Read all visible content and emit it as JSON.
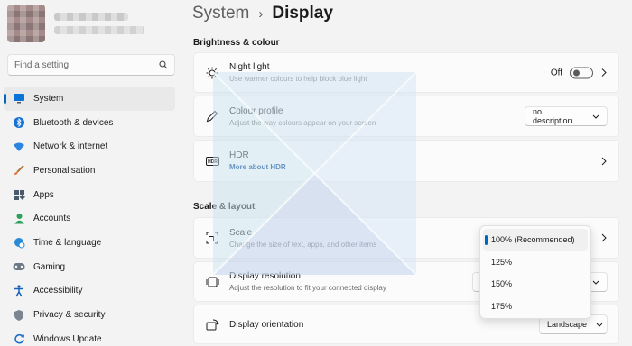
{
  "search": {
    "placeholder": "Find a setting"
  },
  "sidebar": {
    "items": [
      {
        "label": "System",
        "icon": "system-icon",
        "active": true
      },
      {
        "label": "Bluetooth & devices",
        "icon": "bluetooth-icon"
      },
      {
        "label": "Network & internet",
        "icon": "wifi-icon"
      },
      {
        "label": "Personalisation",
        "icon": "brush-icon"
      },
      {
        "label": "Apps",
        "icon": "apps-icon"
      },
      {
        "label": "Accounts",
        "icon": "account-icon"
      },
      {
        "label": "Time & language",
        "icon": "globe-clock-icon"
      },
      {
        "label": "Gaming",
        "icon": "gamepad-icon"
      },
      {
        "label": "Accessibility",
        "icon": "accessibility-icon"
      },
      {
        "label": "Privacy & security",
        "icon": "shield-icon"
      },
      {
        "label": "Windows Update",
        "icon": "update-icon"
      }
    ]
  },
  "header": {
    "parent": "System",
    "separator": "›",
    "current": "Display"
  },
  "sections": {
    "brightness": "Brightness & colour",
    "scale_layout": "Scale & layout"
  },
  "cards": {
    "night_light": {
      "title": "Night light",
      "subtitle": "Use warmer colours to help block blue light",
      "toggle_label": "Off",
      "toggle_on": false
    },
    "colour_profile": {
      "title": "Colour profile",
      "subtitle": "Adjust the way colours appear on your screen",
      "dropdown_value": "no description"
    },
    "hdr": {
      "title": "HDR",
      "link": "More about HDR",
      "icon_text": "HDR"
    },
    "scale": {
      "title": "Scale",
      "subtitle": "Change the size of text, apps, and other items"
    },
    "resolution": {
      "title": "Display resolution",
      "subtitle": "Adjust the resolution to fit your connected display"
    },
    "orientation": {
      "title": "Display orientation",
      "dropdown_value": "Landscape"
    }
  },
  "scale_flyout": {
    "options": [
      "100% (Recommended)",
      "125%",
      "150%",
      "175%"
    ],
    "selected_index": 0
  },
  "colors": {
    "accent": "#0067c0",
    "link": "#003e92",
    "background": "#f3f3f3",
    "card": "#fbfbfb"
  }
}
